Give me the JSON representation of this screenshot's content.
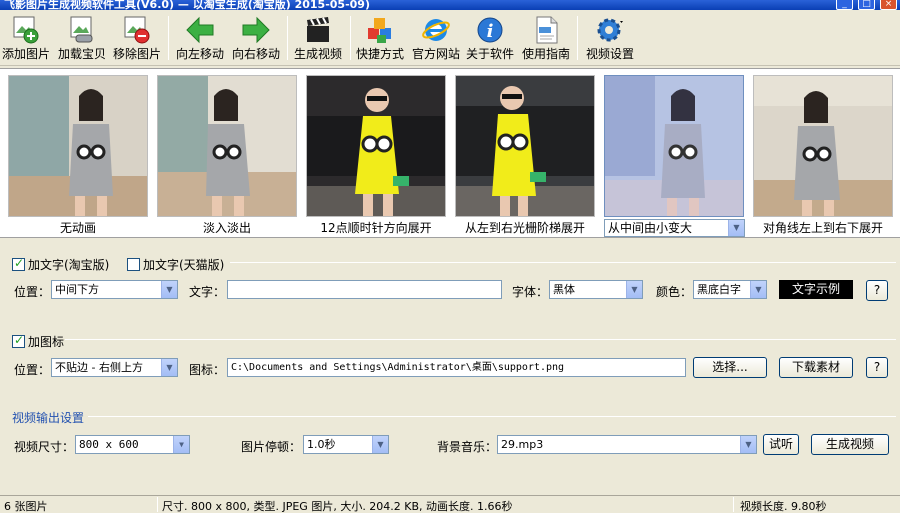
{
  "window": {
    "title": "飞影图片生成视频软件工具(V6.0) — 以淘宝生成(淘宝版) 2015-05-09)"
  },
  "toolbar": {
    "items": [
      {
        "label": "添加图片",
        "icon": "add-image-icon"
      },
      {
        "label": "加载宝贝",
        "icon": "load-items-icon"
      },
      {
        "label": "移除图片",
        "icon": "remove-image-icon"
      },
      {
        "label": "向左移动",
        "icon": "arrow-left-icon"
      },
      {
        "label": "向右移动",
        "icon": "arrow-right-icon"
      },
      {
        "label": "生成视频",
        "icon": "clapperboard-icon"
      },
      {
        "label": "快捷方式",
        "icon": "shortcut-icon"
      },
      {
        "label": "官方网站",
        "icon": "ie-browser-icon"
      },
      {
        "label": "关于软件",
        "icon": "info-icon"
      },
      {
        "label": "使用指南",
        "icon": "guide-icon"
      },
      {
        "label": "视频设置",
        "icon": "gear-icon"
      }
    ]
  },
  "thumbnails": [
    {
      "label": "无动画"
    },
    {
      "label": "淡入淡出"
    },
    {
      "label": "12点顺时针方向展开"
    },
    {
      "label": "从左到右光栅阶梯展开"
    },
    {
      "label": "从中间由小变大"
    },
    {
      "label": "对角线左上到右下展开"
    }
  ],
  "text_group": {
    "taobao_label": "加文字(淘宝版)",
    "taobao_checked": true,
    "tmall_label": "加文字(天猫版)",
    "tmall_checked": false,
    "position_label": "位置：",
    "position_value": "中间下方",
    "text_label": "文字：",
    "text_value": "",
    "font_label": "字体：",
    "font_value": "黑体",
    "color_label": "颜色：",
    "color_value": "黑底白字",
    "sample_label": "文字示例",
    "help_label": "?"
  },
  "logo_group": {
    "label": "加图标",
    "checked": true,
    "position_label": "位置：",
    "position_value": "不贴边 - 右侧上方",
    "icon_label": "图标：",
    "icon_path": "C:\\Documents and Settings\\Administrator\\桌面\\support.png",
    "choose_label": "选择...",
    "download_label": "下载素材",
    "help_label": "?"
  },
  "output": {
    "title": "视频输出设置",
    "size_label": "视频尺寸：",
    "size_value": "800 x 600",
    "pause_label": "图片停顿：",
    "pause_value": "1.0秒",
    "music_label": "背景音乐：",
    "music_value": "29.mp3",
    "listen_label": "试听",
    "generate_label": "生成视频"
  },
  "status": {
    "count": "6 张图片",
    "info": "尺寸. 800 x 800, 类型. JPEG 图片, 大小. 204.2 KB, 动画长度. 1.66秒",
    "length": "视频长度. 9.80秒"
  },
  "colors": {
    "accent": "#2251b0",
    "titlebar": "#0a3fb4"
  }
}
